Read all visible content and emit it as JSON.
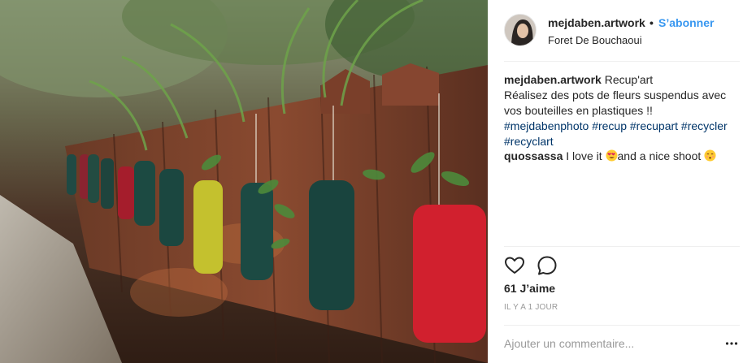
{
  "post": {
    "author": {
      "username": "mejdaben.artwork",
      "separator": "•",
      "follow_label": "S’abonner",
      "location": "Foret De Bouchaoui",
      "avatar_icon": "profile-photo"
    },
    "caption": {
      "username": "mejdaben.artwork",
      "title": "Recup'art",
      "line2": "Réalisez des pots de fleurs suspendus avec",
      "line3": "vos bouteilles en plastiques !!",
      "hashtags_line1": "#mejdabenphoto #recup #recupart #recycler",
      "hashtags_line2": "#recyclart"
    },
    "comments": [
      {
        "username": "quossassa",
        "text_part1": " I love it ",
        "emoji1": "smiling-face-with-heart-eyes",
        "text_part2": "and a nice shoot ",
        "emoji2": "face-blowing-kiss"
      }
    ],
    "actions": {
      "like_icon": "heart-outline-icon",
      "comment_icon": "speech-bubble-icon"
    },
    "likes_label": "61 J’aime",
    "timestamp": "IL Y A 1 JOUR",
    "add_comment_placeholder": "Ajouter un commentaire...",
    "more_icon": "ellipsis-icon",
    "colors": {
      "link": "#3897f0",
      "hashtag": "#003569",
      "muted": "#999999",
      "text": "#262626"
    }
  }
}
